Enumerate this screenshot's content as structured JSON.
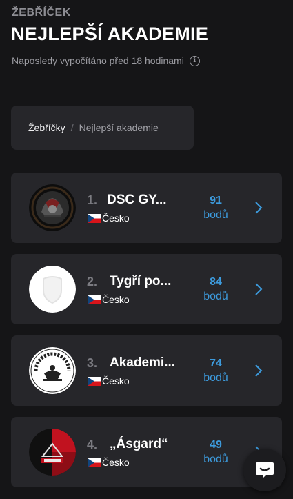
{
  "header": {
    "overline": "ŽEBŘÍČEK",
    "title": "NEJLEPŠÍ AKADEMIE",
    "subtitle": "Naposledy vypočítáno před 18 hodinami",
    "info_icon": "info-icon"
  },
  "breadcrumb": {
    "root": "Žebříčky",
    "separator": "/",
    "current": "Nejlepší akademie"
  },
  "rankings": [
    {
      "rank": "1.",
      "name": "DSC GY...",
      "country": "Česko",
      "points": "91",
      "points_label": "bodů",
      "logo": "dsc-gym-logo"
    },
    {
      "rank": "2.",
      "name": "Tygří po...",
      "country": "Česko",
      "points": "84",
      "points_label": "bodů",
      "logo": "placeholder-shield-logo"
    },
    {
      "rank": "3.",
      "name": "Akademi...",
      "country": "Česko",
      "points": "74",
      "points_label": "bodů",
      "logo": "academy-of-movement-logo"
    },
    {
      "rank": "4.",
      "name": "„Ásgard“",
      "country": "Česko",
      "points": "49",
      "points_label": "bodů",
      "logo": "asgard-logo"
    }
  ],
  "chat_button": {
    "icon": "chat-icon"
  },
  "colors": {
    "background": "#151517",
    "card": "#26262a",
    "accent": "#3d9bdd",
    "muted": "#8d8d93"
  }
}
